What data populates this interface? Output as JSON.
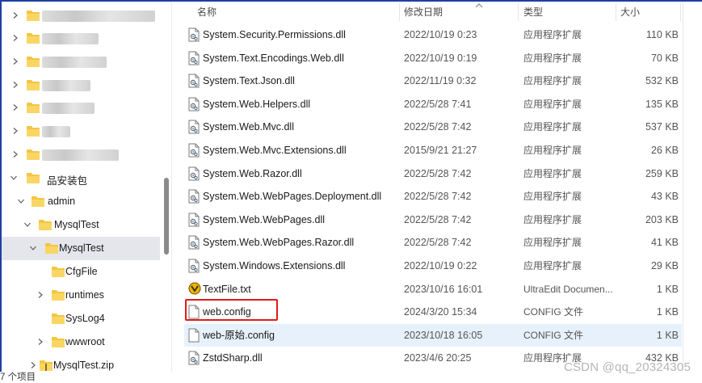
{
  "sidebar": {
    "items": [
      {
        "label": "",
        "blurred": true,
        "blur_w": 140
      },
      {
        "label": "",
        "blurred": true,
        "blur_w": 70
      },
      {
        "label": "",
        "blurred": true,
        "blur_w": 80
      },
      {
        "label": "",
        "blurred": true,
        "blur_w": 60
      },
      {
        "label": "",
        "blurred": true,
        "blur_w": 65
      },
      {
        "label": "",
        "blurred": true,
        "blur_w": 35
      },
      {
        "label": "",
        "blurred": true,
        "blur_w": 95
      },
      {
        "label": "品安装包"
      },
      {
        "label": "admin"
      },
      {
        "label": "MysqlTest"
      },
      {
        "label": "MysqlTest"
      },
      {
        "label": "CfgFile"
      },
      {
        "label": "runtimes"
      },
      {
        "label": "SysLog4"
      },
      {
        "label": "wwwroot"
      },
      {
        "label": "MysqlTest.zip"
      }
    ]
  },
  "columns": {
    "name": "名称",
    "date": "修改日期",
    "type": "类型",
    "size": "大小"
  },
  "files": [
    {
      "name": "System.Security.Permissions.dll",
      "date": "2022/10/19 0:23",
      "type": "应用程序扩展",
      "size": "110 KB",
      "icon": "dll-file-icon"
    },
    {
      "name": "System.Text.Encodings.Web.dll",
      "date": "2022/10/19 0:19",
      "type": "应用程序扩展",
      "size": "70 KB",
      "icon": "dll-file-icon"
    },
    {
      "name": "System.Text.Json.dll",
      "date": "2022/11/19 0:32",
      "type": "应用程序扩展",
      "size": "532 KB",
      "icon": "dll-file-icon"
    },
    {
      "name": "System.Web.Helpers.dll",
      "date": "2022/5/28 7:41",
      "type": "应用程序扩展",
      "size": "135 KB",
      "icon": "dll-file-icon"
    },
    {
      "name": "System.Web.Mvc.dll",
      "date": "2022/5/28 7:42",
      "type": "应用程序扩展",
      "size": "537 KB",
      "icon": "dll-file-icon"
    },
    {
      "name": "System.Web.Mvc.Extensions.dll",
      "date": "2015/9/21 21:27",
      "type": "应用程序扩展",
      "size": "26 KB",
      "icon": "dll-file-icon"
    },
    {
      "name": "System.Web.Razor.dll",
      "date": "2022/5/28 7:42",
      "type": "应用程序扩展",
      "size": "259 KB",
      "icon": "dll-file-icon"
    },
    {
      "name": "System.Web.WebPages.Deployment.dll",
      "date": "2022/5/28 7:42",
      "type": "应用程序扩展",
      "size": "43 KB",
      "icon": "dll-file-icon"
    },
    {
      "name": "System.Web.WebPages.dll",
      "date": "2022/5/28 7:42",
      "type": "应用程序扩展",
      "size": "203 KB",
      "icon": "dll-file-icon"
    },
    {
      "name": "System.Web.WebPages.Razor.dll",
      "date": "2022/5/28 7:42",
      "type": "应用程序扩展",
      "size": "41 KB",
      "icon": "dll-file-icon"
    },
    {
      "name": "System.Windows.Extensions.dll",
      "date": "2022/10/19 0:22",
      "type": "应用程序扩展",
      "size": "29 KB",
      "icon": "dll-file-icon"
    },
    {
      "name": "TextFile.txt",
      "date": "2023/10/16 16:01",
      "type": "UltraEdit Documen...",
      "size": "1 KB",
      "icon": "ultraedit-file-icon"
    },
    {
      "name": "web.config",
      "date": "2024/3/20 15:34",
      "type": "CONFIG 文件",
      "size": "1 KB",
      "icon": "blank-file-icon"
    },
    {
      "name": "web-原始.config",
      "date": "2023/10/18 16:05",
      "type": "CONFIG 文件",
      "size": "1 KB",
      "icon": "blank-file-icon"
    },
    {
      "name": "ZstdSharp.dll",
      "date": "2023/4/6 20:25",
      "type": "应用程序扩展",
      "size": "432 KB",
      "icon": "dll-file-icon"
    }
  ],
  "status": {
    "item_count": "7 个项目"
  },
  "watermark": "CSDN @qq_20324305",
  "colors": {
    "folder": "#f4c542",
    "selected_tree": "#e4e6eb",
    "selected_row": "#e7f1fb",
    "highlight": "#e11b1b"
  }
}
